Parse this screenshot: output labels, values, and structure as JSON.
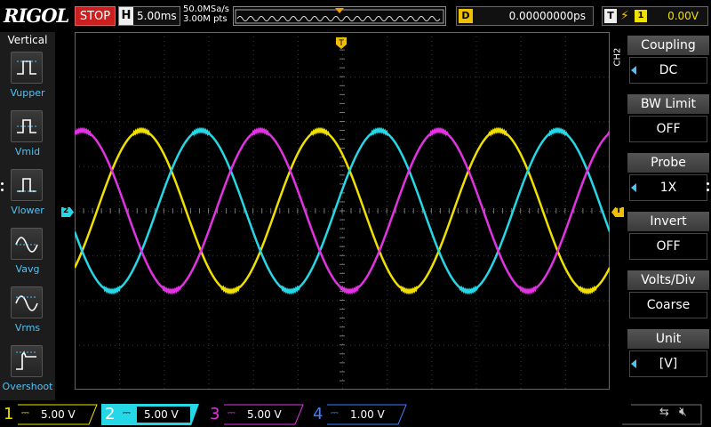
{
  "brand": "RIGOL",
  "run_state": "STOP",
  "horizontal": {
    "label": "H",
    "timebase": "5.00ms"
  },
  "acquisition": {
    "sample_rate": "50.0MSa/s",
    "points": "3.00M pts"
  },
  "delay": {
    "label": "D",
    "value": "0.00000000ps"
  },
  "trigger": {
    "label": "T",
    "edge_icon": "rising-edge-icon",
    "source": "1",
    "level": "0.00V"
  },
  "left_menu": {
    "title": "Vertical",
    "items": [
      {
        "label": "Vupper",
        "icon": "vupper-icon"
      },
      {
        "label": "Vmid",
        "icon": "vmid-icon"
      },
      {
        "label": "Vlower",
        "icon": "vlower-icon"
      },
      {
        "label": "Vavg",
        "icon": "vavg-icon"
      },
      {
        "label": "Vrms",
        "icon": "vrms-icon"
      },
      {
        "label": "Overshoot",
        "icon": "overshoot-icon"
      }
    ]
  },
  "right_menu": {
    "channel_tag": "CH2",
    "items": [
      {
        "header": "Coupling",
        "value": "DC",
        "has_arrow": true
      },
      {
        "header": "BW Limit",
        "value": "OFF",
        "has_arrow": false
      },
      {
        "header": "Probe",
        "value": "1X",
        "has_arrow": true
      },
      {
        "header": "Invert",
        "value": "OFF",
        "has_arrow": false
      },
      {
        "header": "Volts/Div",
        "value": "Coarse",
        "has_arrow": false
      },
      {
        "header": "Unit",
        "value": "[V]",
        "has_arrow": true
      }
    ]
  },
  "markers": {
    "ch2_marker": "2",
    "trigger_top": "T",
    "trigger_right": "T"
  },
  "channels": [
    {
      "num": "1",
      "scale": "5.00 V",
      "color": "#f0e000",
      "active": false
    },
    {
      "num": "2",
      "scale": "5.00 V",
      "color": "#26d7e6",
      "active": true
    },
    {
      "num": "3",
      "scale": "5.00 V",
      "color": "#e233e2",
      "active": false
    },
    {
      "num": "4",
      "scale": "1.00 V",
      "color": "#3d7fff",
      "active": false
    }
  ],
  "chart_data": {
    "type": "line",
    "title": "",
    "xlabel": "",
    "ylabel": "",
    "x_unit": "ms",
    "divisions": {
      "horizontal": 12,
      "vertical": 8
    },
    "series": [
      {
        "name": "CH1",
        "color": "#f0e000",
        "amplitude_v": 9,
        "offset_v": 0,
        "period_ms": 20,
        "phase_deg": 135
      },
      {
        "name": "CH2",
        "color": "#26d7e6",
        "amplitude_v": 9,
        "offset_v": 0,
        "period_ms": 20,
        "phase_deg": 15
      },
      {
        "name": "CH3",
        "color": "#e233e2",
        "amplitude_v": 9,
        "offset_v": 0,
        "period_ms": 20,
        "phase_deg": 255
      }
    ]
  }
}
